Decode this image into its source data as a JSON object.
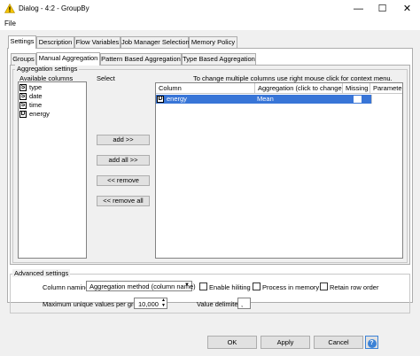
{
  "window": {
    "title": "Dialog - 4:2 - GroupBy"
  },
  "menu": {
    "file": "File"
  },
  "top_tabs": [
    "Settings",
    "Description",
    "Flow Variables",
    "Job Manager Selection",
    "Memory Policy"
  ],
  "sub_tabs": [
    "Groups",
    "Manual Aggregation",
    "Pattern Based Aggregation",
    "Type Based Aggregation"
  ],
  "aggregation_settings": {
    "legend": "Aggregation settings",
    "available_label": "Available columns",
    "select_label": "Select",
    "hint": "To change multiple columns use right mouse click for context menu.",
    "available": [
      {
        "type": "S",
        "name": "type"
      },
      {
        "type": "S",
        "name": "date"
      },
      {
        "type": "S",
        "name": "time"
      },
      {
        "type": "D",
        "name": "energy"
      }
    ],
    "buttons": {
      "add": "add >>",
      "add_all": "add all >>",
      "remove": "<< remove",
      "remove_all": "<< remove all"
    },
    "table": {
      "headers": [
        "Column",
        "Aggregation (click to change)",
        "Missing",
        "Parameter"
      ],
      "rows": [
        {
          "type": "D",
          "column": "energy",
          "aggregation": "Mean",
          "missing": false,
          "parameter": ""
        }
      ]
    }
  },
  "advanced": {
    "legend": "Advanced settings",
    "column_naming_label": "Column naming:",
    "column_naming_value": "Aggregation method (column name)",
    "enable_hiliting": "Enable hiliting",
    "process_in_memory": "Process in memory",
    "retain_row_order": "Retain row order",
    "max_unique_label": "Maximum unique values per group",
    "max_unique_value": "10,000",
    "value_delimiter_label": "Value delimiter",
    "value_delimiter_value": ","
  },
  "footer": {
    "ok": "OK",
    "apply": "Apply",
    "cancel": "Cancel",
    "help": "?"
  },
  "colors": {
    "selection": "#3875d7",
    "accent_help": "#3c82d6"
  }
}
